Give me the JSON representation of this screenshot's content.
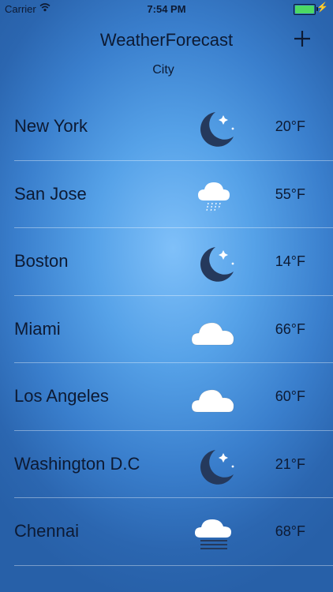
{
  "status_bar": {
    "carrier": "Carrier",
    "time": "7:54 PM"
  },
  "nav": {
    "title": "WeatherForecast",
    "add_icon": "plus-icon"
  },
  "section_header": "City",
  "cities": [
    {
      "name": "New York",
      "temp": "20°F",
      "icon": "night"
    },
    {
      "name": "San Jose",
      "temp": "55°F",
      "icon": "rain"
    },
    {
      "name": "Boston",
      "temp": "14°F",
      "icon": "night"
    },
    {
      "name": "Miami",
      "temp": "66°F",
      "icon": "cloud"
    },
    {
      "name": "Los Angeles",
      "temp": "60°F",
      "icon": "cloud"
    },
    {
      "name": "Washington D.C",
      "temp": "21°F",
      "icon": "night"
    },
    {
      "name": "Chennai",
      "temp": "68°F",
      "icon": "fog"
    }
  ],
  "colors": {
    "text": "#0d1a33",
    "moon": "#25395c",
    "cloud": "#ffffff",
    "battery": "#4cd964",
    "accent_bg": "#56a2e8"
  }
}
